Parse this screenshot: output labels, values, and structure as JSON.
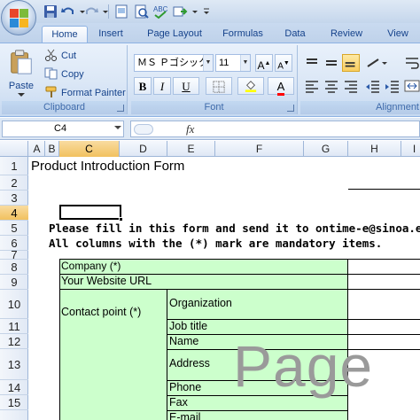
{
  "qat": {
    "icons": [
      "save-icon",
      "undo-icon",
      "redo-icon",
      "page-setup-icon",
      "print-preview-icon",
      "spelling-icon",
      "send-icon",
      "customize-qat-icon"
    ]
  },
  "tabs": [
    "Home",
    "Insert",
    "Page Layout",
    "Formulas",
    "Data",
    "Review",
    "View"
  ],
  "ribbon": {
    "clipboard": {
      "paste": "Paste",
      "cut": "Cut",
      "copy": "Copy",
      "format_painter": "Format Painter",
      "label": "Clipboard"
    },
    "font": {
      "font_name": "ＭＳ Ｐゴシック",
      "font_size": "11",
      "bold": "B",
      "italic": "I",
      "underline": "U",
      "label": "Font"
    },
    "alignment": {
      "label": "Alignment"
    }
  },
  "formula_bar": {
    "name_box": "C4",
    "fx": "fx"
  },
  "columns": [
    "A",
    "B",
    "C",
    "D",
    "E",
    "F",
    "G",
    "H",
    "I"
  ],
  "selected_column": "C",
  "rows": [
    "1",
    "2",
    "3",
    "4",
    "5",
    "6",
    "7",
    "8",
    "9",
    "10",
    "11",
    "12",
    "13",
    "14",
    "15"
  ],
  "selected_row": "4",
  "sheet": {
    "title": "Product Introduction Form",
    "instruction_1": "Please fill in this form and send it to ontime-e@sinoa.east.n",
    "instruction_2": "All columns with the (*) mark are mandatory items.",
    "company": "Company (*)",
    "website": "Your Website URL",
    "contact": "Contact point (*)",
    "organization": "Organization",
    "job_title": "Job title",
    "name": "Name",
    "address": "Address",
    "phone": "Phone",
    "fax": "Fax",
    "email": "E-mail",
    "watermark": "Page"
  }
}
